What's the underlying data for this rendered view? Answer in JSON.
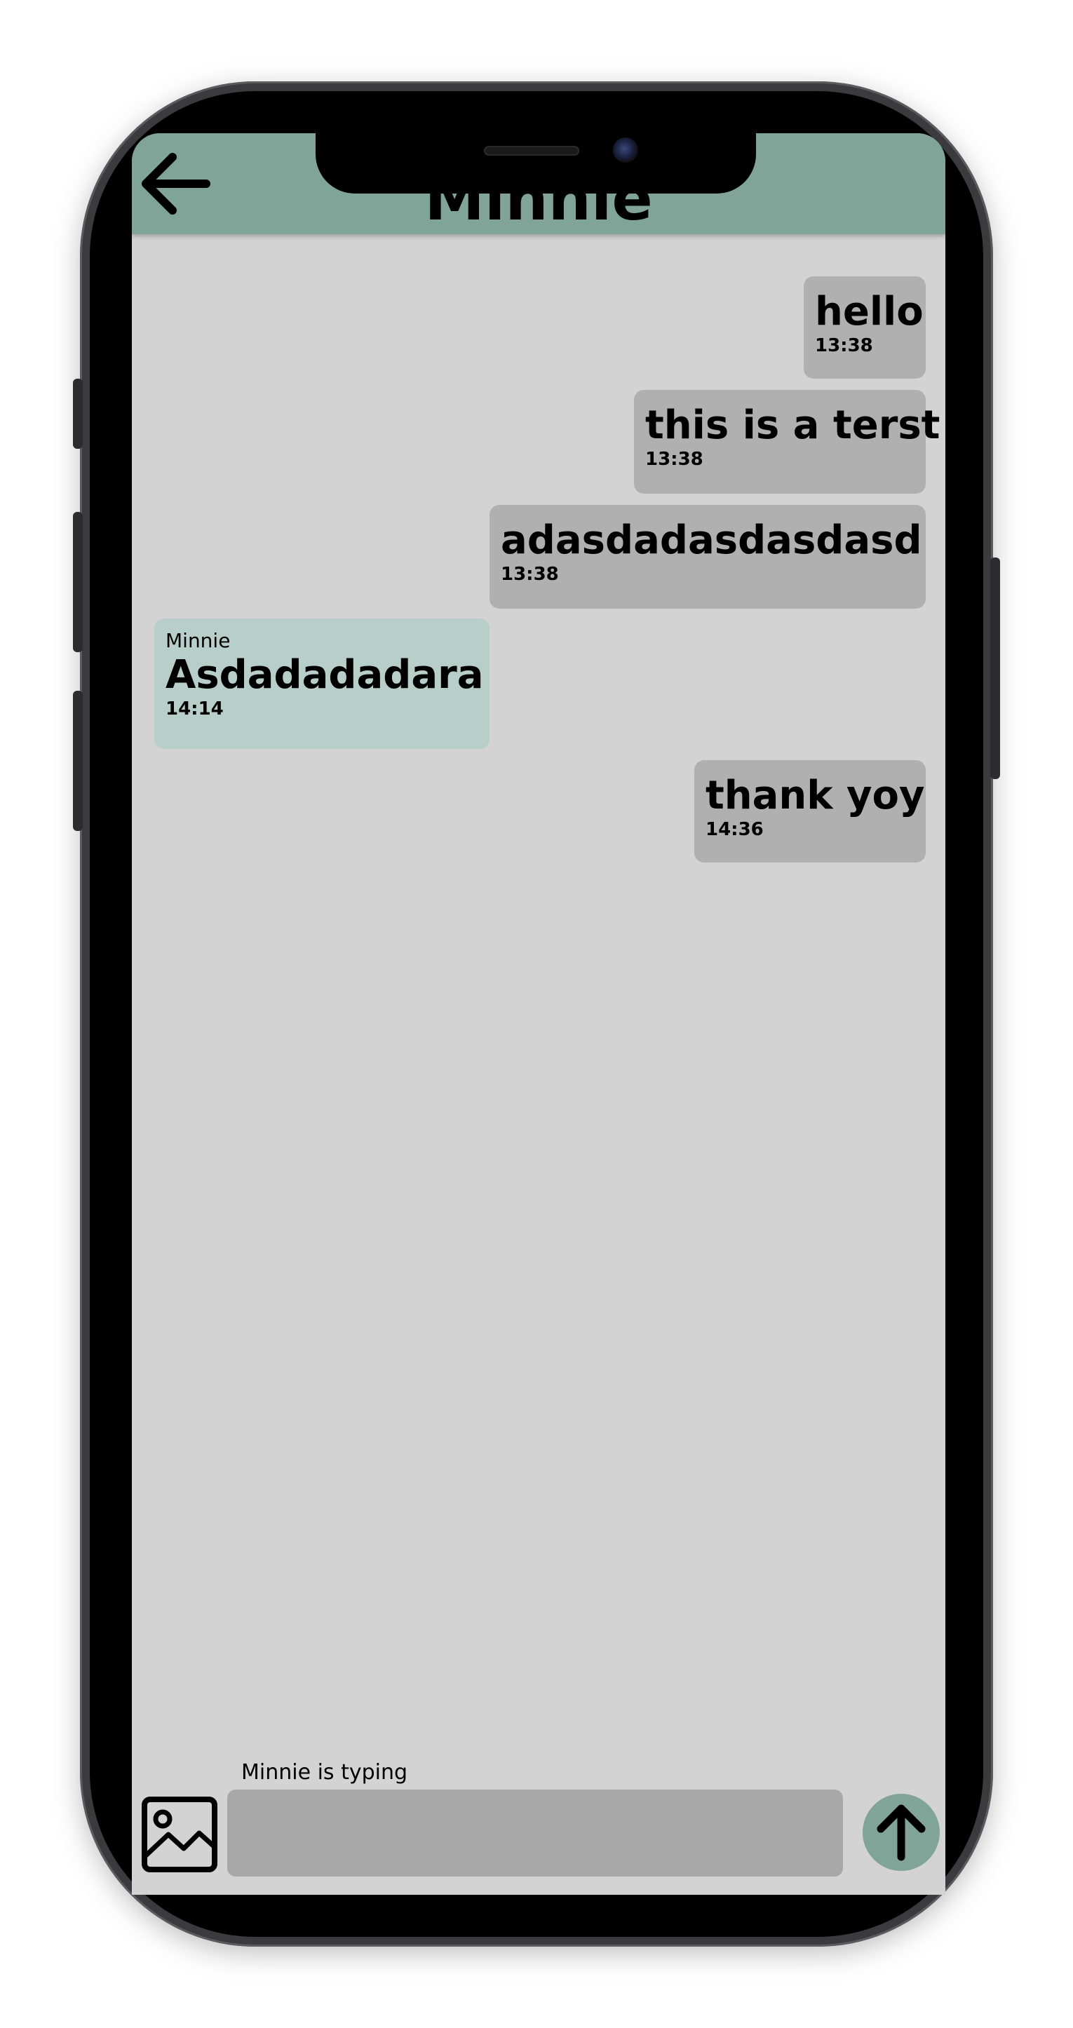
{
  "header": {
    "title": "Minnie"
  },
  "messages": [
    {
      "direction": "outgoing",
      "text": "hello",
      "time": "13:38"
    },
    {
      "direction": "outgoing",
      "text": "this is a terst",
      "time": "13:38"
    },
    {
      "direction": "outgoing",
      "text": "adasdadasdasdasd",
      "time": "13:38"
    },
    {
      "direction": "incoming",
      "sender": "Minnie",
      "text": "Asdadadadara",
      "time": "14:14"
    },
    {
      "direction": "outgoing",
      "text": "thank yoy",
      "time": "14:36"
    }
  ],
  "composer": {
    "typing_indicator": "Minnie is typing",
    "input_value": "",
    "image_button_icon": "image-icon",
    "send_button_icon": "arrow-up-icon"
  },
  "navigation": {
    "back_icon": "arrow-left-icon"
  },
  "colors": {
    "header": "#80a497",
    "background": "#d3d3d3",
    "outgoing_bubble": "#b0b0b0",
    "incoming_bubble": "#b7cfc8",
    "input": "#a8a8a8",
    "send_button": "#80a497"
  }
}
